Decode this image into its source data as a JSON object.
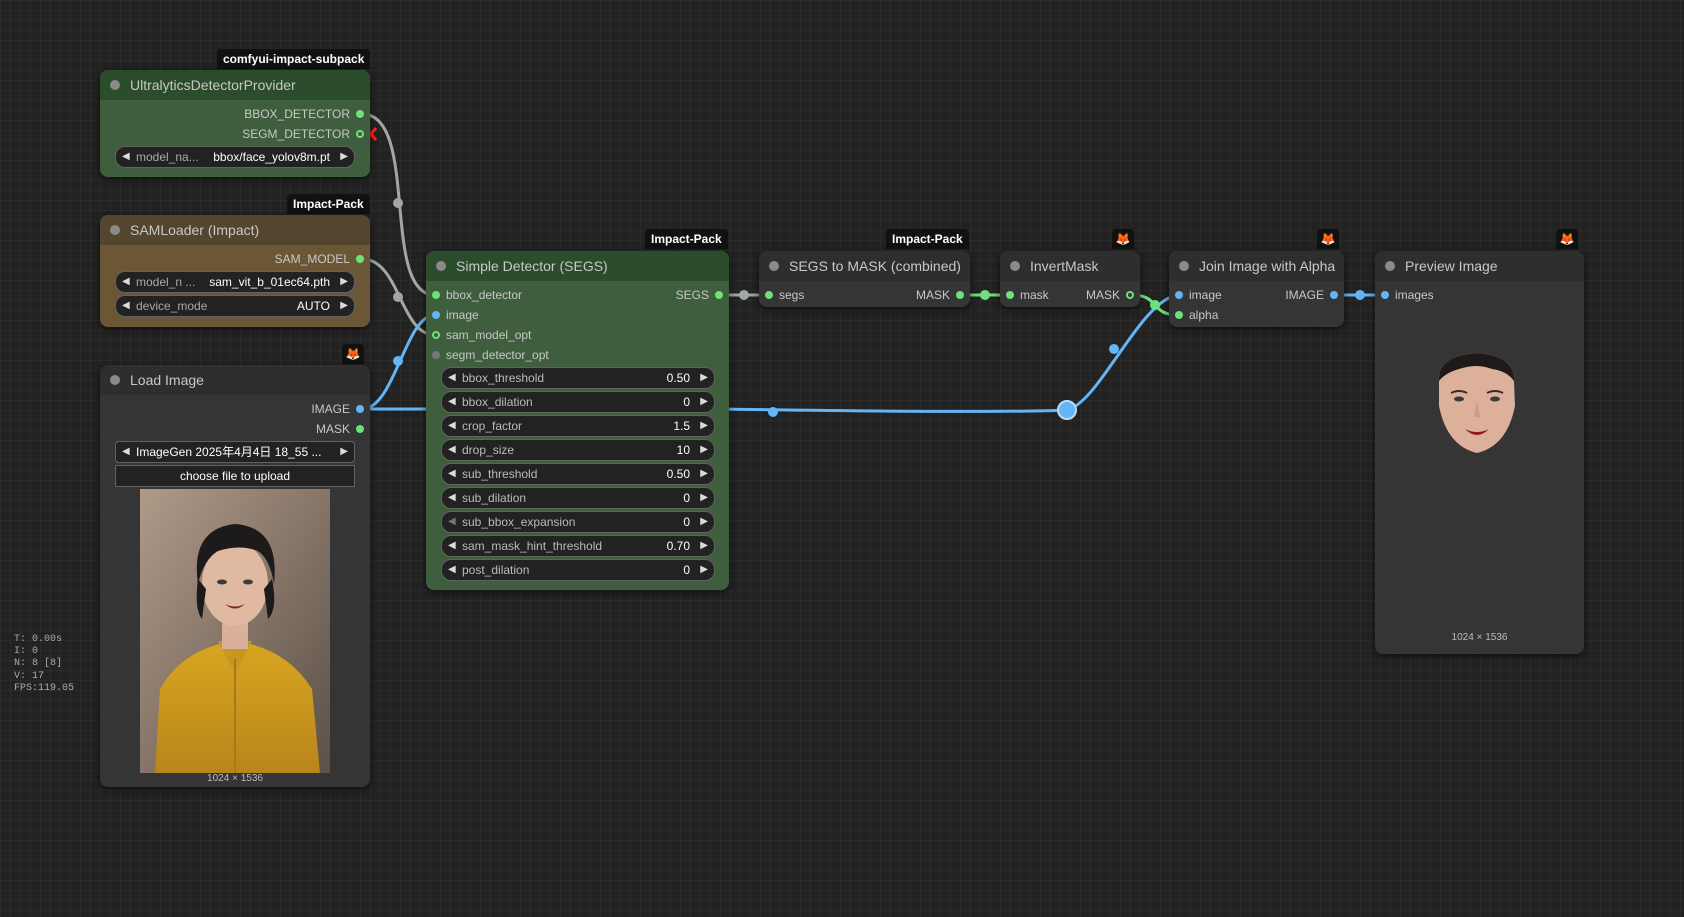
{
  "nodes": {
    "ultralytics": {
      "badge": "comfyui-impact-subpack",
      "title": "UltralyticsDetectorProvider",
      "outputs": [
        "BBOX_DETECTOR",
        "SEGM_DETECTOR"
      ],
      "widget_label": "model_na...",
      "widget_value": "bbox/face_yolov8m.pt",
      "colors": {
        "title": "#2b4d2b",
        "body": "#3e5e3e"
      }
    },
    "samloader": {
      "badge": "Impact-Pack",
      "title": "SAMLoader (Impact)",
      "output": "SAM_MODEL",
      "model_label": "model_n ...",
      "model_value": "sam_vit_b_01ec64.pth",
      "device_label": "device_mode",
      "device_value": "AUTO",
      "colors": {
        "title": "#54452e",
        "body": "#6b5636"
      }
    },
    "loadimage": {
      "badge_icon": "fox-icon",
      "title": "Load Image",
      "outputs": [
        "IMAGE",
        "MASK"
      ],
      "image_name": "ImageGen 2025年4月4日 18_55 ...",
      "upload_label": "choose file to upload",
      "dimensions": "1024 × 1536"
    },
    "detector": {
      "badge": "Impact-Pack",
      "title": "Simple Detector (SEGS)",
      "inputs": [
        "bbox_detector",
        "image",
        "sam_model_opt",
        "segm_detector_opt"
      ],
      "output": "SEGS",
      "widgets": [
        {
          "label": "bbox_threshold",
          "value": "0.50"
        },
        {
          "label": "bbox_dilation",
          "value": "0"
        },
        {
          "label": "crop_factor",
          "value": "1.5"
        },
        {
          "label": "drop_size",
          "value": "10"
        },
        {
          "label": "sub_threshold",
          "value": "0.50"
        },
        {
          "label": "sub_dilation",
          "value": "0"
        },
        {
          "label": "sub_bbox_expansion",
          "value": "0"
        },
        {
          "label": "sam_mask_hint_threshold",
          "value": "0.70"
        },
        {
          "label": "post_dilation",
          "value": "0"
        }
      ],
      "colors": {
        "title": "#2b4d2b",
        "body": "#3e5e3e"
      }
    },
    "segstomask": {
      "badge": "Impact-Pack",
      "title": "SEGS to MASK (combined)",
      "input": "segs",
      "output": "MASK"
    },
    "invertmask": {
      "badge_icon": "fox-icon",
      "title": "InvertMask",
      "input": "mask",
      "output": "MASK"
    },
    "joinalpha": {
      "badge_icon": "fox-icon",
      "title": "Join Image with Alpha",
      "inputs": [
        "image",
        "alpha"
      ],
      "output": "IMAGE"
    },
    "preview": {
      "badge_icon": "fox-icon",
      "title": "Preview Image",
      "input": "images",
      "dimensions": "1024 × 1536"
    }
  },
  "stats": {
    "t": "T: 0.00s",
    "i": "I: 0",
    "n": "N: 8 [8]",
    "v": "V: 17",
    "fps": "FPS:119.05"
  },
  "colors": {
    "background": "#222222",
    "node_body": "#353535",
    "image_link": "#64b5f6",
    "mask_link": "#6fe07a",
    "generic_link": "#a0a8a0",
    "error_mark": "#ff2020"
  }
}
